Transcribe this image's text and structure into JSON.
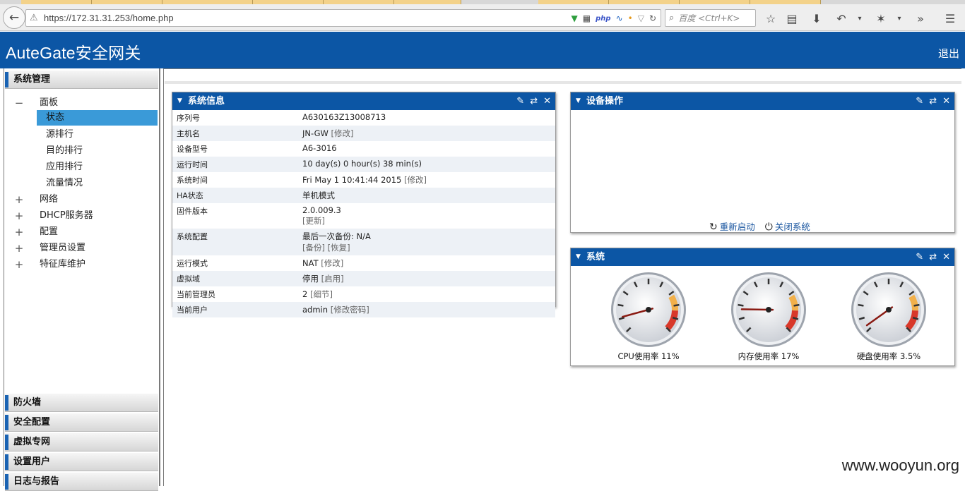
{
  "browser": {
    "url": "https://172.31.31.253/home.php",
    "search_placeholder": "百度 <Ctrl+K>"
  },
  "app": {
    "title": "AuteGate安全网关",
    "logout": "退出"
  },
  "sidebar": {
    "top_section": "系统管理",
    "tree": [
      {
        "toggle": "−",
        "label": "面板",
        "children": [
          "状态",
          "源排行",
          "目的排行",
          "应用排行",
          "流量情况"
        ],
        "active": "状态"
      },
      {
        "toggle": "+",
        "label": "网络"
      },
      {
        "toggle": "+",
        "label": "DHCP服务器"
      },
      {
        "toggle": "+",
        "label": "配置"
      },
      {
        "toggle": "+",
        "label": "管理员设置"
      },
      {
        "toggle": "+",
        "label": "特征库维护"
      }
    ],
    "sections": [
      "防火墙",
      "安全配置",
      "虚拟专网",
      "设置用户",
      "日志与报告"
    ]
  },
  "sysinfo": {
    "title": "系统信息",
    "rows": [
      {
        "key": "序列号",
        "value": "A630163Z13008713",
        "link": ""
      },
      {
        "key": "主机名",
        "value": "JN-GW",
        "link": "[修改]"
      },
      {
        "key": "设备型号",
        "value": "A6-3016",
        "link": ""
      },
      {
        "key": "运行时间",
        "value": "10 day(s) 0 hour(s) 38 min(s)",
        "link": ""
      },
      {
        "key": "系统时间",
        "value": "Fri May 1 10:41:44 2015",
        "link": "[修改]"
      },
      {
        "key": "HA状态",
        "value": "单机模式",
        "link": ""
      },
      {
        "key": "固件版本",
        "value": "2.0.009.3",
        "link": "[更新]"
      },
      {
        "key": "系统配置",
        "value": "最后一次备份: N/A",
        "link": "[备份] [恢复]"
      },
      {
        "key": "运行模式",
        "value": "NAT",
        "link": "[修改]"
      },
      {
        "key": "虚拟域",
        "value": "停用",
        "link": "[启用]"
      },
      {
        "key": "当前管理员",
        "value": "2",
        "link": "[细节]"
      },
      {
        "key": "当前用户",
        "value": "admin",
        "link": "[修改密码]"
      }
    ]
  },
  "devops": {
    "title": "设备操作",
    "restart": "重新启动",
    "shutdown": "关闭系统"
  },
  "system": {
    "title": "系统",
    "gauges": [
      {
        "label": "CPU使用率 11%",
        "percent": 11
      },
      {
        "label": "内存使用率 17%",
        "percent": 17
      },
      {
        "label": "硬盘使用率 3.5%",
        "percent": 3.5
      }
    ]
  },
  "watermark": "www.wooyun.org"
}
